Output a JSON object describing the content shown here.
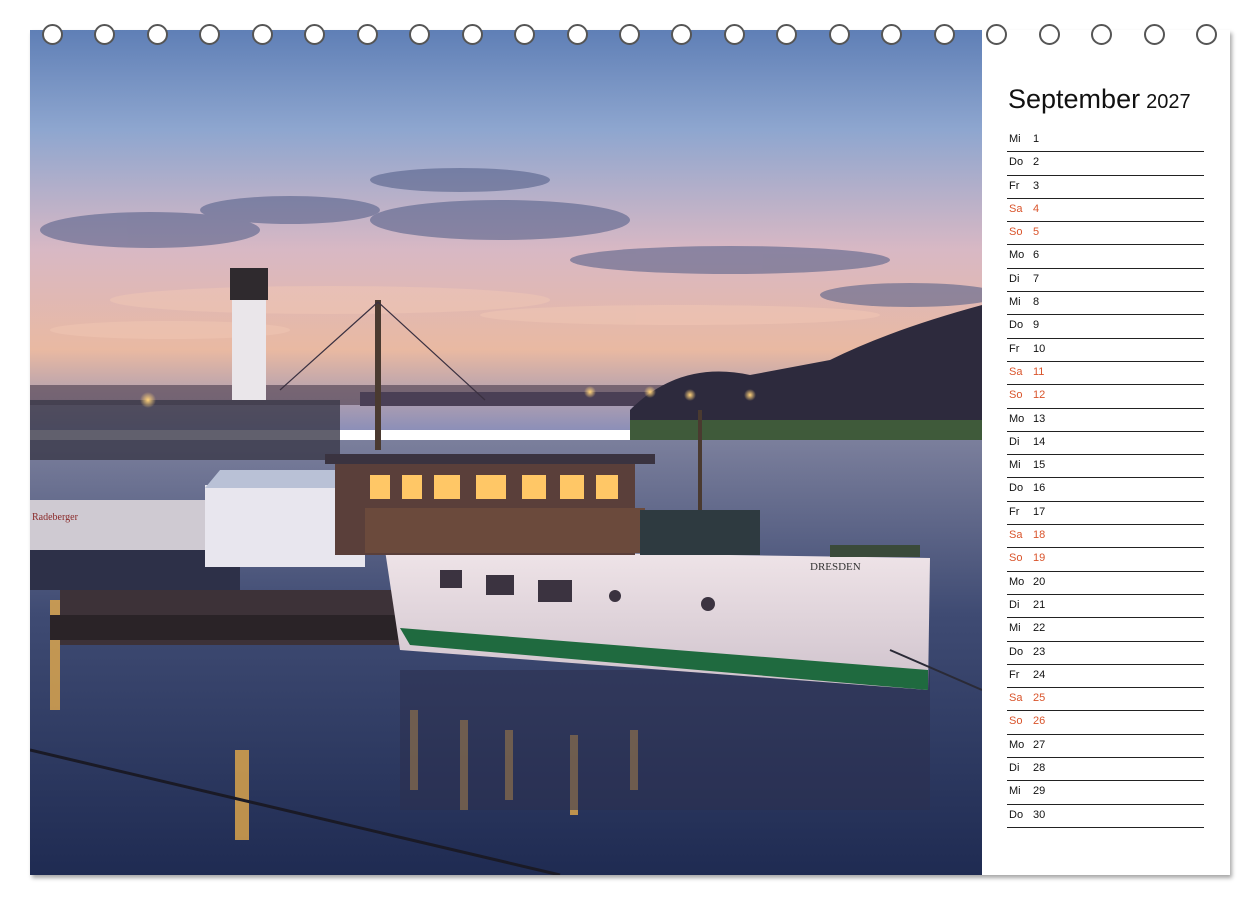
{
  "calendar": {
    "month": "September",
    "year": "2027",
    "weekend_color": "#d9542b",
    "days": [
      {
        "wd": "Mi",
        "n": "1",
        "we": false
      },
      {
        "wd": "Do",
        "n": "2",
        "we": false
      },
      {
        "wd": "Fr",
        "n": "3",
        "we": false
      },
      {
        "wd": "Sa",
        "n": "4",
        "we": true
      },
      {
        "wd": "So",
        "n": "5",
        "we": true
      },
      {
        "wd": "Mo",
        "n": "6",
        "we": false
      },
      {
        "wd": "Di",
        "n": "7",
        "we": false
      },
      {
        "wd": "Mi",
        "n": "8",
        "we": false
      },
      {
        "wd": "Do",
        "n": "9",
        "we": false
      },
      {
        "wd": "Fr",
        "n": "10",
        "we": false
      },
      {
        "wd": "Sa",
        "n": "11",
        "we": true
      },
      {
        "wd": "So",
        "n": "12",
        "we": true
      },
      {
        "wd": "Mo",
        "n": "13",
        "we": false
      },
      {
        "wd": "Di",
        "n": "14",
        "we": false
      },
      {
        "wd": "Mi",
        "n": "15",
        "we": false
      },
      {
        "wd": "Do",
        "n": "16",
        "we": false
      },
      {
        "wd": "Fr",
        "n": "17",
        "we": false
      },
      {
        "wd": "Sa",
        "n": "18",
        "we": true
      },
      {
        "wd": "So",
        "n": "19",
        "we": true
      },
      {
        "wd": "Mo",
        "n": "20",
        "we": false
      },
      {
        "wd": "Di",
        "n": "21",
        "we": false
      },
      {
        "wd": "Mi",
        "n": "22",
        "we": false
      },
      {
        "wd": "Do",
        "n": "23",
        "we": false
      },
      {
        "wd": "Fr",
        "n": "24",
        "we": false
      },
      {
        "wd": "Sa",
        "n": "25",
        "we": true
      },
      {
        "wd": "So",
        "n": "26",
        "we": true
      },
      {
        "wd": "Mo",
        "n": "27",
        "we": false
      },
      {
        "wd": "Di",
        "n": "28",
        "we": false
      },
      {
        "wd": "Mi",
        "n": "29",
        "we": false
      },
      {
        "wd": "Do",
        "n": "30",
        "we": false
      }
    ]
  },
  "photo": {
    "ship_name": "DRESDEN",
    "sign_text": "Radeberger"
  }
}
